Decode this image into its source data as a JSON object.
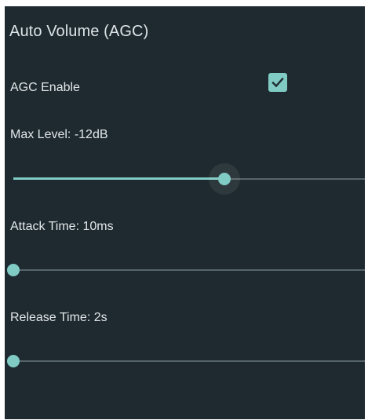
{
  "section": {
    "title": "Auto Volume (AGC)"
  },
  "agc_enable": {
    "label": "AGC Enable",
    "checked": true,
    "icon": "checkmark-icon"
  },
  "max_level": {
    "label": "Max Level: -12dB",
    "fraction": 0.6
  },
  "attack_time": {
    "label": "Attack Time: 10ms",
    "fraction": 0.0
  },
  "release_time": {
    "label": "Release Time: 2s",
    "fraction": 0.0
  },
  "colors": {
    "background": "#1f2a30",
    "accent": "#80cbc4",
    "text": "#e3e8eb",
    "track": "#56646b"
  }
}
